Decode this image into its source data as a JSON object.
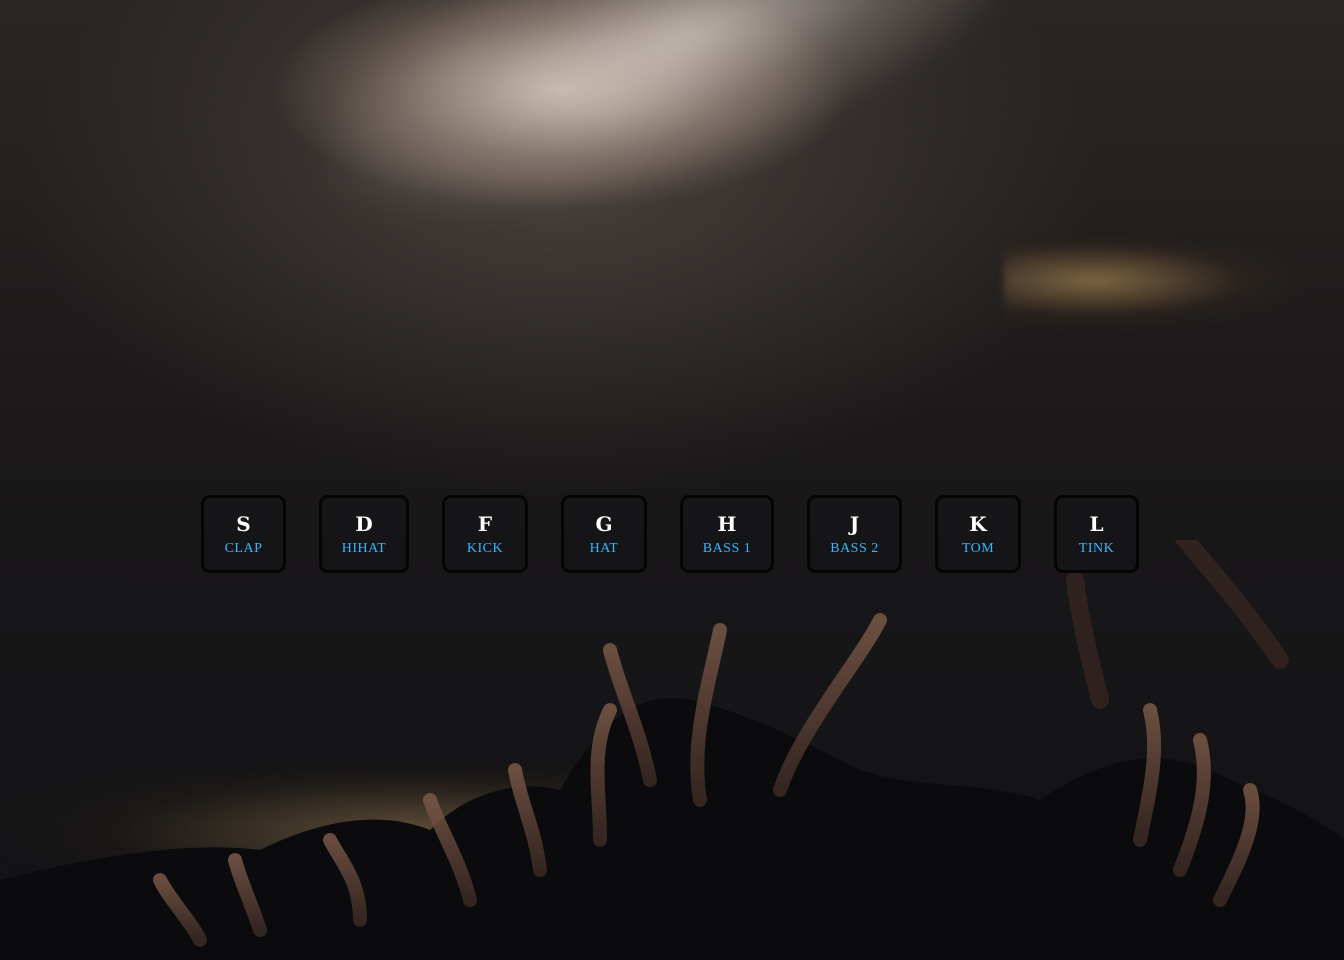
{
  "keys": [
    {
      "letter": "S",
      "sound": "CLAP"
    },
    {
      "letter": "D",
      "sound": "HIHAT"
    },
    {
      "letter": "F",
      "sound": "KICK"
    },
    {
      "letter": "G",
      "sound": "HAT"
    },
    {
      "letter": "H",
      "sound": "BASS 1"
    },
    {
      "letter": "J",
      "sound": "BASS 2"
    },
    {
      "letter": "K",
      "sound": "TOM"
    },
    {
      "letter": "L",
      "sound": "TINK"
    }
  ],
  "colors": {
    "label_accent": "#35b6ff",
    "key_text": "#ffffff",
    "key_border": "#050506"
  },
  "background": "concert-crowd-photo"
}
